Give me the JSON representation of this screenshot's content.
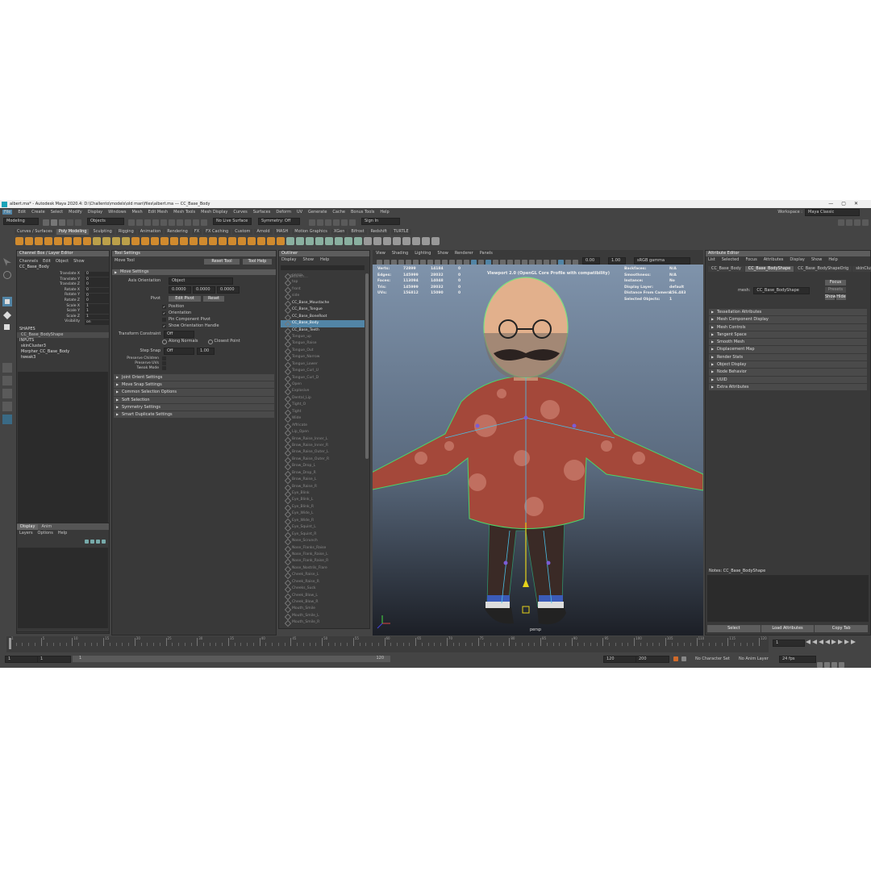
{
  "title_bar": {
    "text": "albert.ma* - Autodesk Maya 2020.4: D:\\Challento\\models\\old man\\files\\albert.ma  ---  CC_Base_Body",
    "controls": [
      "—",
      "▢",
      "✕"
    ]
  },
  "menubar": {
    "items": [
      "File",
      "Edit",
      "Create",
      "Select",
      "Modify",
      "Display",
      "Windows",
      "Mesh",
      "Edit Mesh",
      "Mesh Tools",
      "Mesh Display",
      "Curves",
      "Surfaces",
      "Deform",
      "UV",
      "Generate",
      "Cache",
      "Bonus Tools",
      "Help"
    ],
    "workspace_label": "Workspace :",
    "workspace_value": "Maya Classic"
  },
  "status_line": {
    "mode": "Modeling",
    "objects": "Objects",
    "live_surface": "No Live Surface",
    "symmetry": "Symmetry: Off",
    "sign_in": "Sign In"
  },
  "shelf": {
    "tabs": [
      "Curves / Surfaces",
      "Poly Modeling",
      "Sculpting",
      "Rigging",
      "Animation",
      "Rendering",
      "FX",
      "FX Caching",
      "Custom",
      "Arnold",
      "MASH",
      "Motion Graphics",
      "XGen",
      "Bifrost",
      "Redshift",
      "TURTLE"
    ],
    "active_tab": "Poly Modeling"
  },
  "channel_box": {
    "header": "Channel Box / Layer Editor",
    "menu": [
      "Channels",
      "Edit",
      "Object",
      "Show"
    ],
    "object": "CC_Base_Body",
    "channels": [
      {
        "name": "Translate X",
        "value": "0"
      },
      {
        "name": "Translate Y",
        "value": "0"
      },
      {
        "name": "Translate Z",
        "value": "0"
      },
      {
        "name": "Rotate X",
        "value": "0"
      },
      {
        "name": "Rotate Y",
        "value": "0"
      },
      {
        "name": "Rotate Z",
        "value": "0"
      },
      {
        "name": "Scale X",
        "value": "1"
      },
      {
        "name": "Scale Y",
        "value": "1"
      },
      {
        "name": "Scale Z",
        "value": "1"
      },
      {
        "name": "Visibility",
        "value": "on"
      }
    ],
    "shapes_label": "SHAPES",
    "shape_item": "CC_Base_BodyShape",
    "inputs_label": "INPUTS",
    "inputs": [
      "skinCluster3",
      "Morpher_CC_Base_Body",
      "tweak3"
    ],
    "layer_tabs": [
      "Display",
      "Anim"
    ],
    "layer_menu": [
      "Layers",
      "Options",
      "Help"
    ]
  },
  "tool_settings": {
    "header": "Tool Settings",
    "tool_name": "Move Tool",
    "reset_button": "Reset Tool",
    "help_button": "Tool Help",
    "section_move": "Move Settings",
    "axis_orientation_label": "Axis Orientation",
    "axis_orientation_value": "Object",
    "axis_values": [
      "0.0000",
      "0.0000",
      "0.0000"
    ],
    "pivot_label": "Pivot",
    "edit_pivot": "Edit Pivot",
    "reset": "Reset",
    "checks": [
      {
        "label": "Position",
        "checked": true
      },
      {
        "label": "Orientation",
        "checked": true
      },
      {
        "label": "Pin Component Pivot",
        "checked": false
      },
      {
        "label": "Show Orientation Handle",
        "checked": true
      }
    ],
    "transform_constraint_label": "Transform Constraint",
    "transform_constraint_value": "Off",
    "along_normals": "Along Normals",
    "closest_point": "Closest Point",
    "step_snap_label": "Step Snap",
    "step_snap_value": "Off",
    "step_snap_num": "1.00",
    "preserve_labels": [
      "Preserve Children",
      "Preserve UVs",
      "Tweak Mode"
    ],
    "sections": [
      "Joint Orient Settings",
      "Move Snap Settings",
      "Common Selection Options",
      "Soft Selection",
      "Symmetry Settings",
      "Smart Duplicate Settings"
    ]
  },
  "outliner": {
    "header": "Outliner",
    "menu": [
      "Display",
      "Show",
      "Help"
    ],
    "search_placeholder": "Search...",
    "items": [
      {
        "label": "persp",
        "state": "dim"
      },
      {
        "label": "top",
        "state": "dim"
      },
      {
        "label": "front",
        "state": "dim"
      },
      {
        "label": "side",
        "state": "dim"
      },
      {
        "label": "CC_Base_Moustache",
        "state": "hi"
      },
      {
        "label": "CC_Base_Tongue",
        "state": "hi"
      },
      {
        "label": "CC_Base_BoneRoot",
        "state": "hi"
      },
      {
        "label": "CC_Base_Body",
        "state": "sel"
      },
      {
        "label": "CC_Base_Teeth",
        "state": "hi"
      },
      {
        "label": "Tongue_up",
        "state": "dim"
      },
      {
        "label": "Tongue_Raise",
        "state": "dim"
      },
      {
        "label": "Tongue_Out",
        "state": "dim"
      },
      {
        "label": "Tongue_Narrow",
        "state": "dim"
      },
      {
        "label": "Tongue_Lower",
        "state": "dim"
      },
      {
        "label": "Tongue_Curl_U",
        "state": "dim"
      },
      {
        "label": "Tongue_Curl_D",
        "state": "dim"
      },
      {
        "label": "Open",
        "state": "dim"
      },
      {
        "label": "Explosive",
        "state": "dim"
      },
      {
        "label": "Dental_Lip",
        "state": "dim"
      },
      {
        "label": "Tight_O",
        "state": "dim"
      },
      {
        "label": "Tight",
        "state": "dim"
      },
      {
        "label": "Wide",
        "state": "dim"
      },
      {
        "label": "Affricate",
        "state": "dim"
      },
      {
        "label": "Lip_Open",
        "state": "dim"
      },
      {
        "label": "Brow_Raise_Inner_L",
        "state": "dim"
      },
      {
        "label": "Brow_Raise_Inner_R",
        "state": "dim"
      },
      {
        "label": "Brow_Raise_Outer_L",
        "state": "dim"
      },
      {
        "label": "Brow_Raise_Outer_R",
        "state": "dim"
      },
      {
        "label": "Brow_Drop_L",
        "state": "dim"
      },
      {
        "label": "Brow_Drop_R",
        "state": "dim"
      },
      {
        "label": "Brow_Raise_L",
        "state": "dim"
      },
      {
        "label": "Brow_Raise_R",
        "state": "dim"
      },
      {
        "label": "Eye_Blink",
        "state": "dim"
      },
      {
        "label": "Eye_Blink_L",
        "state": "dim"
      },
      {
        "label": "Eye_Blink_R",
        "state": "dim"
      },
      {
        "label": "Eye_Wide_L",
        "state": "dim"
      },
      {
        "label": "Eye_Wide_R",
        "state": "dim"
      },
      {
        "label": "Eye_Squint_L",
        "state": "dim"
      },
      {
        "label": "Eye_Squint_R",
        "state": "dim"
      },
      {
        "label": "Nose_Scrunch",
        "state": "dim"
      },
      {
        "label": "Nose_Flanks_Raise",
        "state": "dim"
      },
      {
        "label": "Nose_Flank_Raise_L",
        "state": "dim"
      },
      {
        "label": "Nose_Flank_Raise_R",
        "state": "dim"
      },
      {
        "label": "Nose_Nostrils_Flare",
        "state": "dim"
      },
      {
        "label": "Cheek_Raise_L",
        "state": "dim"
      },
      {
        "label": "Cheek_Raise_R",
        "state": "dim"
      },
      {
        "label": "Cheeks_Suck",
        "state": "dim"
      },
      {
        "label": "Cheek_Blow_L",
        "state": "dim"
      },
      {
        "label": "Cheek_Blow_R",
        "state": "dim"
      },
      {
        "label": "Mouth_Smile",
        "state": "dim"
      },
      {
        "label": "Mouth_Smile_L",
        "state": "dim"
      },
      {
        "label": "Mouth_Smile_R",
        "state": "dim"
      }
    ]
  },
  "viewport": {
    "menu": [
      "View",
      "Shading",
      "Lighting",
      "Show",
      "Renderer",
      "Panels"
    ],
    "gamma_value": "0.00",
    "exposure_value": "1.00",
    "color_space": "sRGB gamma",
    "hud_headers": [
      "Verts:",
      "Edges:",
      "Faces:",
      "Tris:",
      "UVs:"
    ],
    "hud_rows": [
      [
        "Verts:",
        "72899",
        "14184",
        "0"
      ],
      [
        "Edges:",
        "145999",
        "28032",
        "0"
      ],
      [
        "Faces:",
        "113094",
        "14048",
        "0"
      ],
      [
        "Tris:",
        "145999",
        "28032",
        "0"
      ],
      [
        "UVs:",
        "156812",
        "15090",
        "0"
      ]
    ],
    "renderer_text": "Viewport 2.0 (OpenGL Core Profile with compatibility)",
    "hud_right": [
      [
        "Backfaces:",
        "N/A"
      ],
      [
        "Smoothness:",
        "N/A"
      ],
      [
        "Instance:",
        "No"
      ],
      [
        "Display Layer:",
        "default"
      ],
      [
        "Distance From Camera:",
        "156.483"
      ],
      [
        "Selected Objects:",
        "1"
      ]
    ],
    "camera_label": "persp"
  },
  "attribute_editor": {
    "header": "Attribute Editor",
    "menu": [
      "List",
      "Selected",
      "Focus",
      "Attributes",
      "Display",
      "Show",
      "Help"
    ],
    "tabs": [
      "CC_Base_Body",
      "CC_Base_BodyShape",
      "CC_Base_BodyShapeOrig",
      "skinCluster3"
    ],
    "active_tab": "CC_Base_BodyShape",
    "mesh_label": "mesh:",
    "mesh_value": "CC_Base_BodyShape",
    "focus_btn": "Focus",
    "presets_btn": "Presets",
    "show_btn": "Show",
    "hide_btn": "Hide",
    "sections": [
      "Tessellation Attributes",
      "Mesh Component Display",
      "Mesh Controls",
      "Tangent Space",
      "Smooth Mesh",
      "Displacement Map",
      "Render Stats",
      "Object Display",
      "Node Behavior",
      "UUID",
      "Extra Attributes"
    ],
    "notes_label": "Notes: CC_Base_BodyShape",
    "bottom_buttons": [
      "Select",
      "Load Attributes",
      "Copy Tab"
    ]
  },
  "timeline": {
    "ticks": [
      "1",
      "5",
      "10",
      "15",
      "20",
      "25",
      "30",
      "35",
      "40",
      "45",
      "50",
      "55",
      "60",
      "65",
      "70",
      "75",
      "80",
      "85",
      "90",
      "95",
      "100",
      "105",
      "110",
      "115",
      "120"
    ],
    "current_frame": "1",
    "start": "1",
    "range_start": "1",
    "range_end_inner": "120",
    "range_end": "120",
    "anim_end": "200",
    "character_set": "No Character Set",
    "anim_layer": "No Anim Layer",
    "fps": "24 fps"
  },
  "colors": {
    "app_bg": "#444444",
    "panel_bg": "#393939",
    "selection": "#5285a6",
    "shelf_icon": "#d08a2e",
    "viewport_top": "#7f93ab",
    "viewport_bottom": "#1c1f26"
  },
  "maya_logo": "M"
}
